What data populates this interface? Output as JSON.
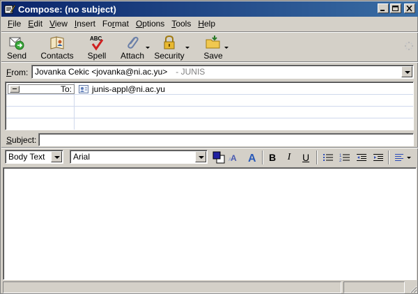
{
  "window": {
    "title": "Compose: (no subject)"
  },
  "menu": [
    {
      "label": "File",
      "key": "F",
      "rest": "ile"
    },
    {
      "label": "Edit",
      "key": "E",
      "rest": "dit"
    },
    {
      "label": "View",
      "key": "V",
      "rest": "iew"
    },
    {
      "label": "Insert",
      "key": "I",
      "rest": "nsert"
    },
    {
      "label": "Format",
      "key": "",
      "pre": "Fo",
      "keymid": "r",
      "rest": "mat"
    },
    {
      "label": "Options",
      "key": "O",
      "rest": "ptions"
    },
    {
      "label": "Tools",
      "key": "T",
      "rest": "ools"
    },
    {
      "label": "Help",
      "key": "H",
      "rest": "elp"
    }
  ],
  "toolbar": {
    "send": "Send",
    "contacts": "Contacts",
    "spell": "Spell",
    "attach": "Attach",
    "security": "Security",
    "save": "Save"
  },
  "from": {
    "label": "From:",
    "value": "Jovanka Cekic <jovanka@ni.ac.yu>",
    "account": "- JUNIS"
  },
  "addressing": {
    "rows": [
      {
        "type": "To:",
        "value": "junis-appl@ni.ac.yu"
      }
    ]
  },
  "subject": {
    "label": "Subject:",
    "value": ""
  },
  "format": {
    "paragraph": "Body Text",
    "font": "Arial",
    "bold": "B",
    "italic": "I",
    "underline": "U"
  },
  "colors": {
    "title_start": "#0a246a",
    "title_end": "#3a6ea5",
    "chrome": "#d4d0c8"
  }
}
